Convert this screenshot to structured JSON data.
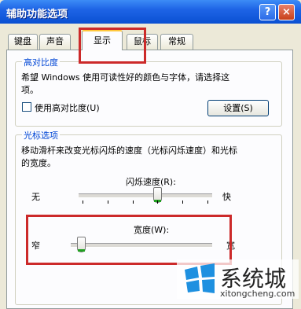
{
  "window": {
    "title": "辅助功能选项",
    "help_label": "?",
    "close_label": "×"
  },
  "tabs": [
    {
      "label": "键盘"
    },
    {
      "label": "声音"
    },
    {
      "label": "显示",
      "active": true
    },
    {
      "label": "鼠标"
    },
    {
      "label": "常规"
    }
  ],
  "high_contrast": {
    "legend": "高对比度",
    "description_line1": "希望 Windows 使用可读性好的颜色与字体，请选择这",
    "description_line2": "项。",
    "checkbox_label": "使用高对比度(U)",
    "checked": false,
    "settings_button": "设置(S)"
  },
  "cursor_options": {
    "legend": "光标选项",
    "description_line1": "移动滑杆来改变光标闪烁的速度（光标闪烁速度）和光标",
    "description_line2": "的宽度。",
    "blink_rate": {
      "label": "闪烁速度(R):",
      "min_label": "无",
      "max_label": "快",
      "level": 0.6
    },
    "width": {
      "label": "宽度(W):",
      "min_label": "窄",
      "max_label": "宽",
      "level": 0.05
    }
  },
  "watermark": {
    "text": "系统城",
    "url": "xitongcheng.com"
  },
  "colors": {
    "title_bar": "#0a50d2",
    "highlight": "#cc2a2a",
    "legend": "#0046d5"
  }
}
